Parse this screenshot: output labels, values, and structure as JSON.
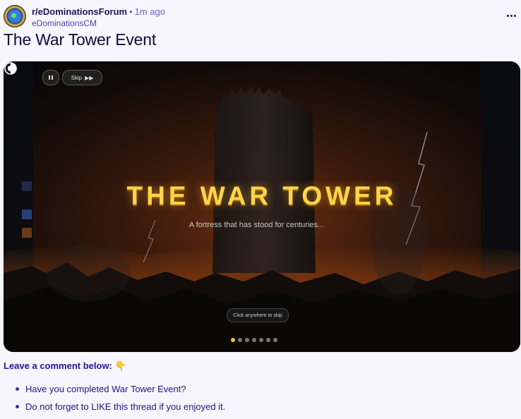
{
  "post": {
    "subreddit": "r/eDominationsForum",
    "separator": "•",
    "time_ago": "1m ago",
    "author": "eDominationsCM",
    "more_icon": "more-horizontal-icon",
    "title": "The War Tower Event"
  },
  "media": {
    "pause_icon": "pause-icon",
    "skip_label": "Skip",
    "skip_icon": "▶▶",
    "headline": "THE WAR TOWER",
    "tagline": "A fortress that has stood for centuries...",
    "click_skip_label": "Click anywhere to skip",
    "slide_count": 7,
    "active_slide": 1,
    "audio_icon": "audio-toggle-icon",
    "colors": {
      "headline": "#ffd44a",
      "active_dot": "#f3c325"
    }
  },
  "body": {
    "comment_prompt": "Leave a comment below: 👇",
    "items": [
      "Have you completed War Tower Event?",
      "Do not forget to LIKE this thread if you enjoyed it."
    ]
  }
}
